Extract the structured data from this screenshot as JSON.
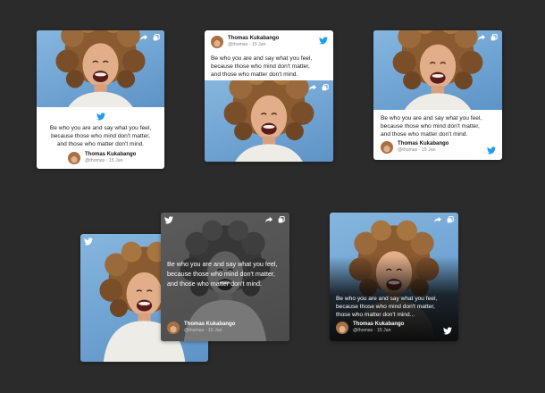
{
  "quote": "Be who you are and say what you feel, because those who mind don't matter, and those who matter don't mind.",
  "quote_lines": [
    "Be who you are and say what you feel,",
    "because those who mind don't matter,",
    "and those who matter don't mind."
  ],
  "quote_lines_ellipsis": [
    "Be who you are and say what you feel,",
    "because those who mind don't matter,",
    "those who matter don't mind..."
  ],
  "author": {
    "name": "Thomas Kukabango",
    "handle": "@thomas",
    "date": "15 Jan",
    "meta": "@thomas · 15 Jan"
  },
  "icons": {
    "share": "share-icon",
    "copy": "copy-icon",
    "twitter": "twitter-bird-icon"
  },
  "colors": {
    "background": "#2b2b2b",
    "twitter_blue": "#1d9bf0",
    "photo_sky": "#6fa3d2"
  }
}
